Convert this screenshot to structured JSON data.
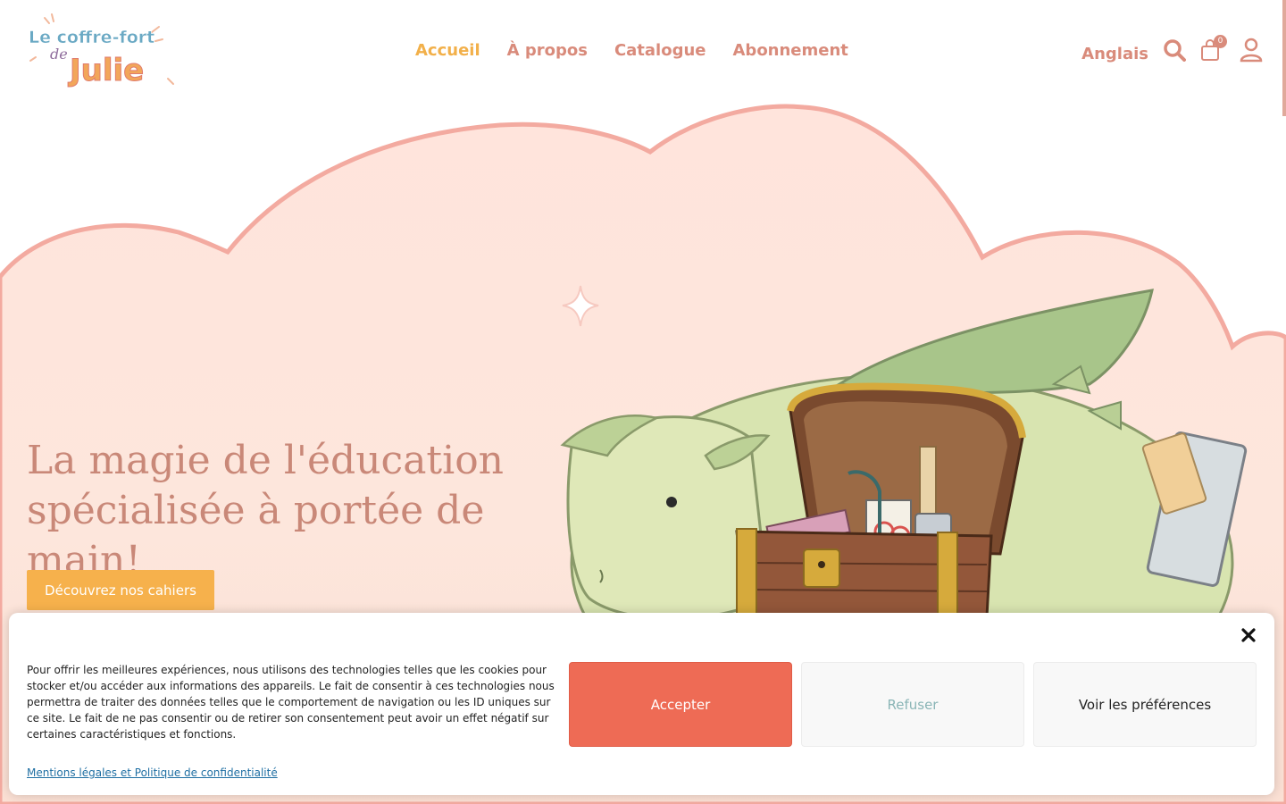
{
  "header": {
    "logo": {
      "line1": "Le coffre-fort",
      "line2": "de",
      "line3": "Julie"
    },
    "nav": [
      {
        "label": "Accueil",
        "active": true
      },
      {
        "label": "À propos",
        "active": false
      },
      {
        "label": "Catalogue",
        "active": false
      },
      {
        "label": "Abonnement",
        "active": false
      }
    ],
    "language": "Anglais",
    "cart_count": "0",
    "icons": [
      "search-icon",
      "cart-icon",
      "account-icon"
    ]
  },
  "hero": {
    "title": "La magie de l'éducation spécialisée à portée de main!",
    "cta_label": "Découvrez nos cahiers",
    "illustration": "dragon-with-treasure-chest"
  },
  "cookie_banner": {
    "text": "Pour offrir les meilleures expériences, nous utilisons des technologies telles que les cookies pour stocker et/ou accéder aux informations des appareils. Le fait de consentir à ces technologies nous permettra de traiter des données telles que le comportement de navigation ou les ID uniques sur ce site. Le fait de ne pas consentir ou de retirer son consentement peut avoir un effet négatif sur certaines caractéristiques et fonctions.",
    "accept_label": "Accepter",
    "refuse_label": "Refuser",
    "preferences_label": "Voir les préférences",
    "legal_link": "Mentions légales et Politique de confidentialité"
  },
  "colors": {
    "nav_text": "#d98b7b",
    "nav_active": "#f2b04a",
    "cta_bg": "#f6b14c",
    "accept_bg": "#ee6b55",
    "hero_cloud": "#fde3da",
    "cloud_outline": "#f3aaa0"
  }
}
